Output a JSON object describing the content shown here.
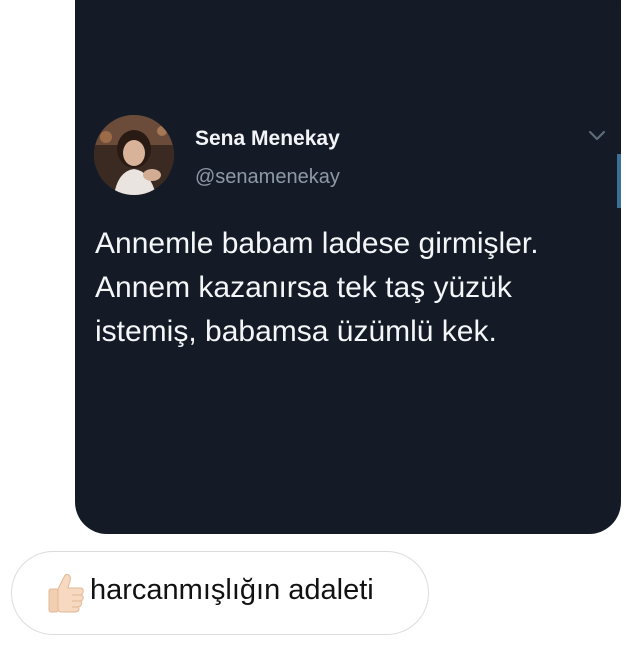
{
  "tweet": {
    "display_name": "Sena Menekay",
    "handle": "@senamenekay",
    "text": "Annemle babam ladese girmişler.\nAnnem kazanırsa tek taş yüzük\nistemiş, babamsa üzümlü kek.",
    "avatar_icon": "user-avatar-photo",
    "menu_icon": "chevron-down-icon",
    "colors": {
      "background": "#141b26",
      "name": "#f2f4f7",
      "handle": "#8e99a6"
    }
  },
  "reply": {
    "emoji_icon": "thumbs-up-icon",
    "text": "harcanmışlığın adaleti"
  }
}
